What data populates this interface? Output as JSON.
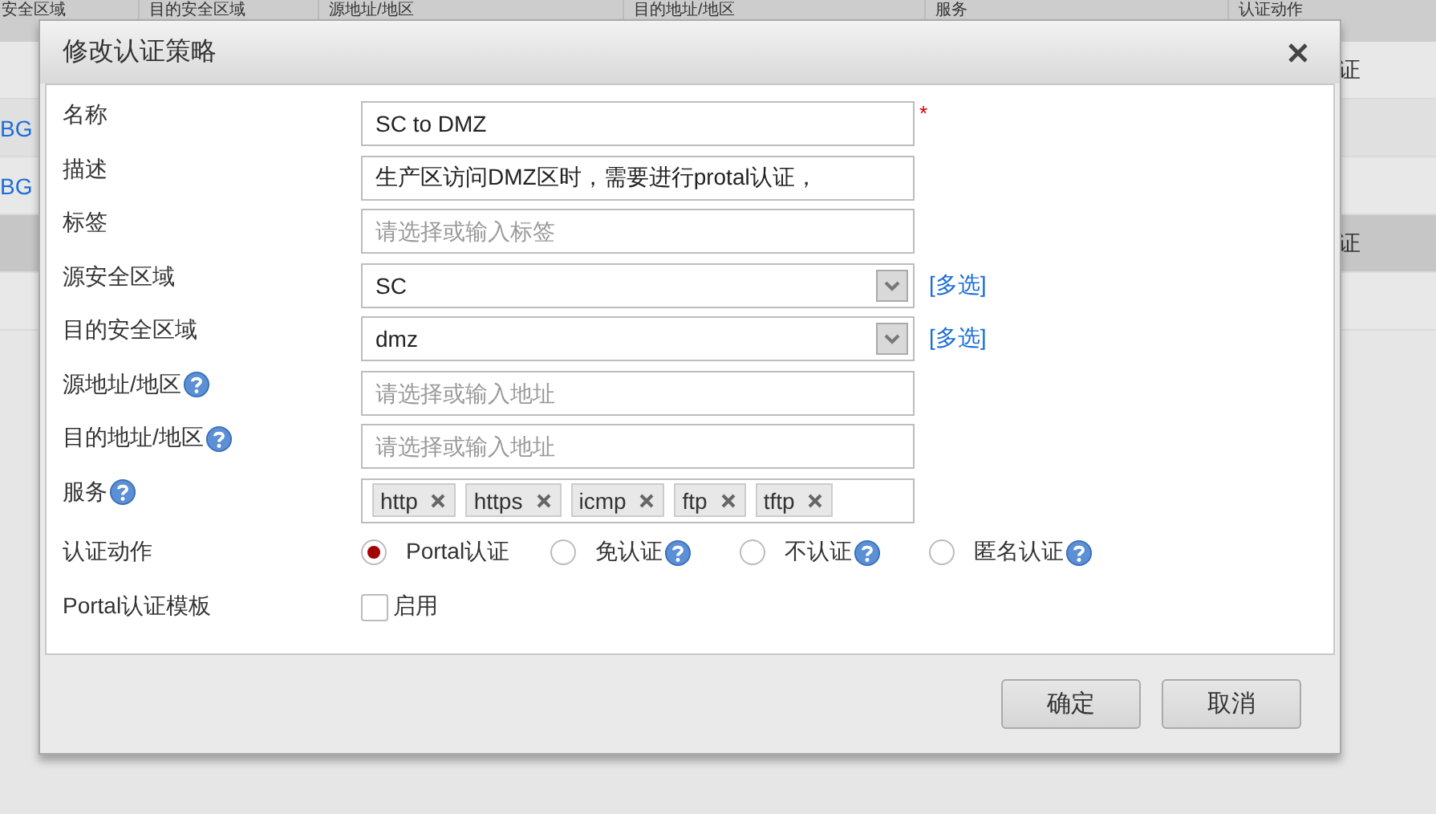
{
  "background_table": {
    "columns": [
      "安全区域",
      "目的安全区域",
      "源地址/地区",
      "目的地址/地区",
      "服务",
      "认证动作"
    ],
    "rows": [
      {
        "right": "证",
        "selected": false
      },
      {
        "left": "BG",
        "selected": false
      },
      {
        "left": "BG",
        "selected": false
      },
      {
        "right": "证",
        "selected": true
      },
      {
        "selected": false
      }
    ]
  },
  "dialog": {
    "title": "修改认证策略",
    "fields": [
      {
        "label": "名称",
        "kind": "text",
        "value": "SC to DMZ",
        "required_mark": "*"
      },
      {
        "label": "描述",
        "kind": "text",
        "value": "生产区访问DMZ区时，需要进行protal认证，"
      },
      {
        "label": "标签",
        "kind": "text",
        "placeholder": "请选择或输入标签"
      },
      {
        "label": "源安全区域",
        "kind": "select",
        "value": "SC",
        "link": "[多选]"
      },
      {
        "label": "目的安全区域",
        "kind": "select",
        "value": "dmz",
        "link": "[多选]"
      },
      {
        "label": "源地址/地区",
        "help": true,
        "kind": "text",
        "placeholder": "请选择或输入地址"
      },
      {
        "label": "目的地址/地区",
        "help": true,
        "kind": "text",
        "placeholder": "请选择或输入地址"
      },
      {
        "label": "服务",
        "help": true,
        "kind": "tags",
        "tags": [
          "http",
          "https",
          "icmp",
          "ftp",
          "tftp"
        ]
      },
      {
        "label": "认证动作",
        "kind": "radio",
        "options": [
          {
            "label": "Portal认证",
            "selected": true
          },
          {
            "label": "免认证",
            "selected": false,
            "help": true
          },
          {
            "label": "不认证",
            "selected": false,
            "help": true
          },
          {
            "label": "匿名认证",
            "selected": false,
            "help": true
          }
        ]
      },
      {
        "label": "Portal认证模板",
        "kind": "checkbox",
        "checkbox": {
          "label": "启用",
          "checked": false
        }
      }
    ],
    "buttons": [
      "确定",
      "取消"
    ]
  }
}
